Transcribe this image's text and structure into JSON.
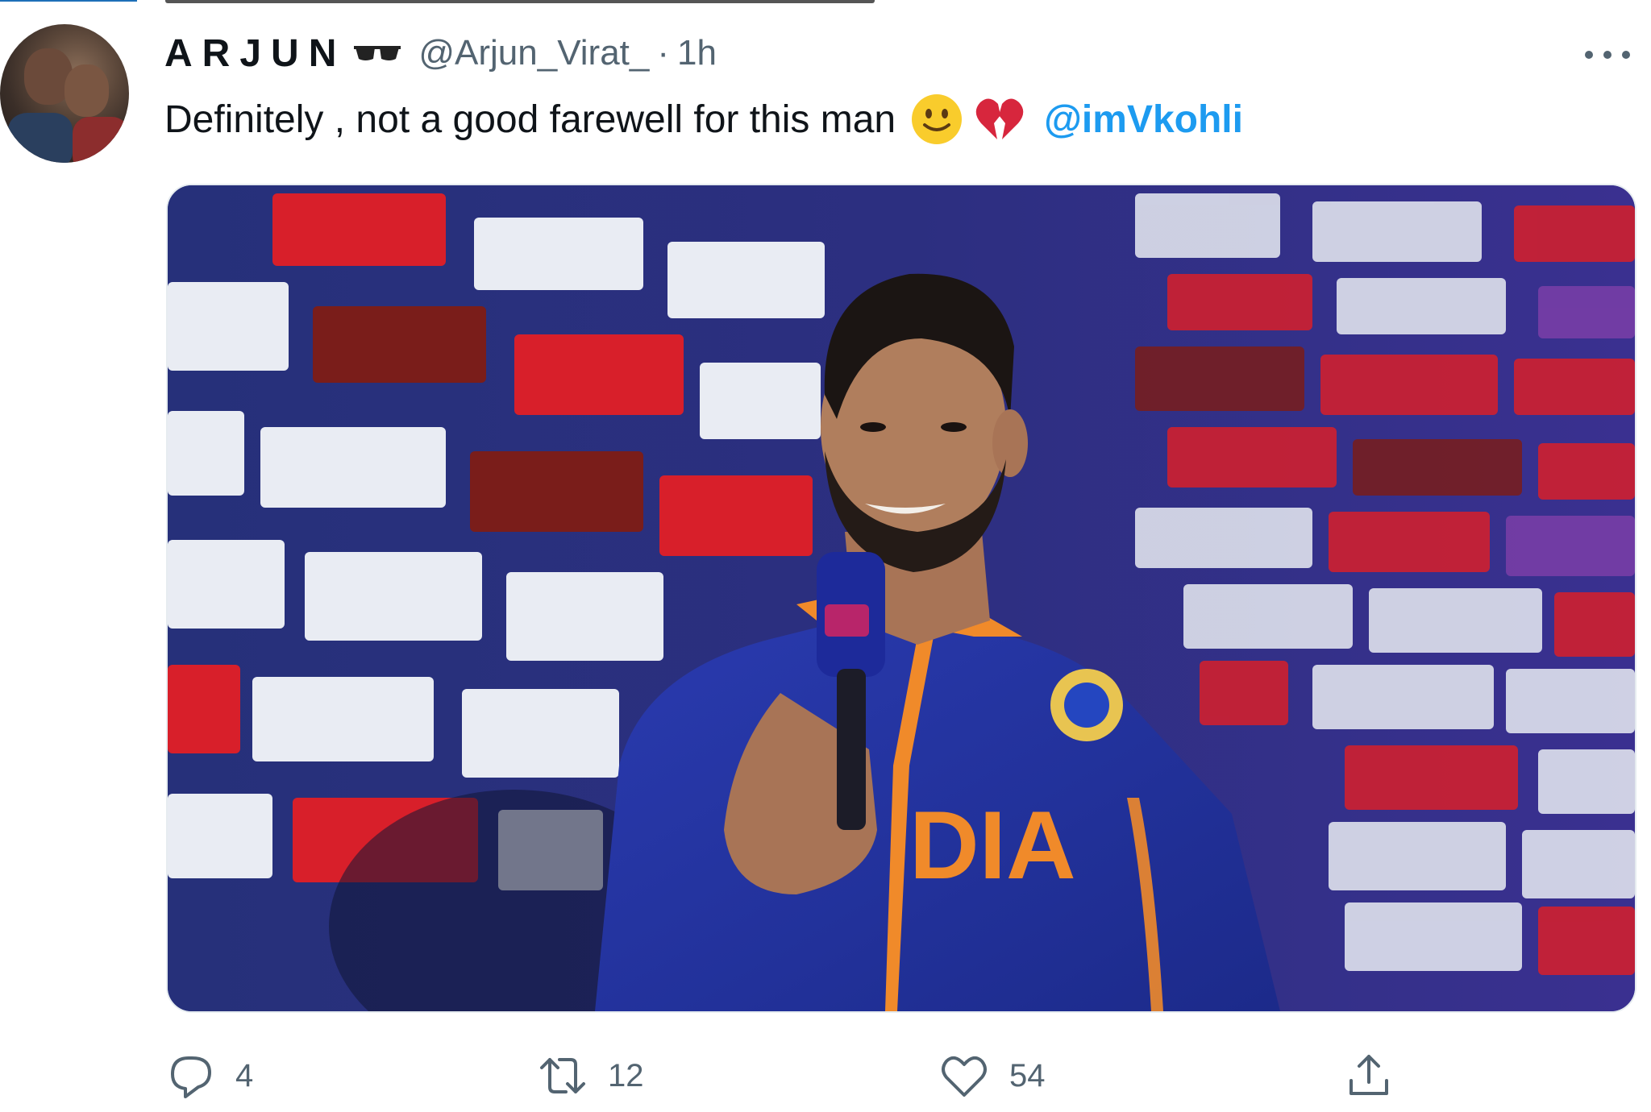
{
  "tweet": {
    "author_name": "ARJUN",
    "author_name_icon": "sunglasses-emoji",
    "handle": "@Arjun_Virat_",
    "separator": "·",
    "time": "1h",
    "text": "Definitely , not a good farewell for this man",
    "emojis": [
      "slightly-smiling-face-emoji",
      "broken-heart-emoji"
    ],
    "mention": "@imVkohli",
    "more_icon": "more-options-icon"
  },
  "media": {
    "description_icon": "photo"
  },
  "actions": {
    "reply": {
      "icon": "reply-icon",
      "count": "4"
    },
    "retweet": {
      "icon": "retweet-icon",
      "count": "12"
    },
    "like": {
      "icon": "heart-icon",
      "count": "54"
    },
    "share": {
      "icon": "share-icon"
    }
  },
  "colors": {
    "link": "#1d9bf0",
    "secondary_text": "#536471",
    "primary_text": "#0f1419"
  }
}
